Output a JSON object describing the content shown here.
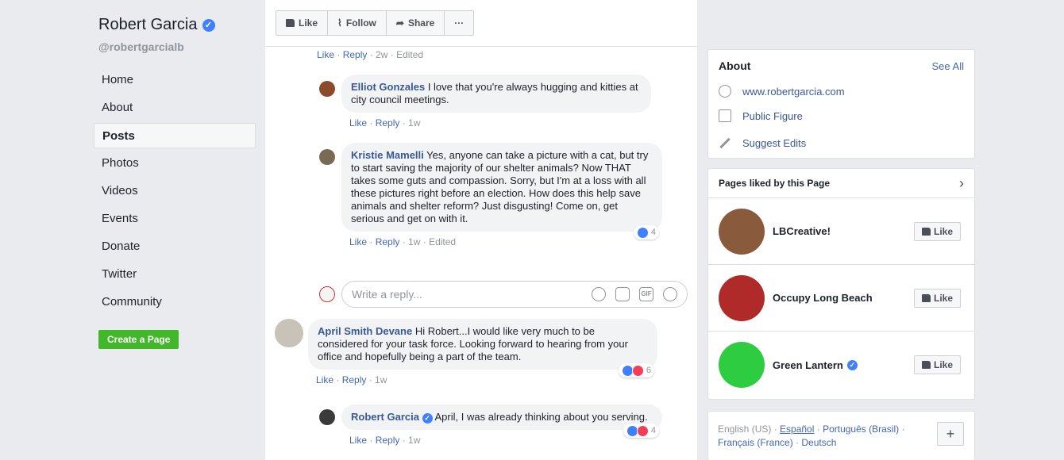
{
  "sidebar": {
    "page_name": "Robert Garcia",
    "handle": "@robertgarcialb",
    "nav": [
      "Home",
      "About",
      "Posts",
      "Photos",
      "Videos",
      "Events",
      "Donate",
      "Twitter",
      "Community"
    ],
    "active_item": "Posts",
    "create_page_label": "Create a Page"
  },
  "actionbar": {
    "like_label": "Like",
    "follow_label": "Follow",
    "share_label": "Share",
    "more_label": "···"
  },
  "comments": [
    {
      "meta": [
        "Like",
        "Reply",
        "2w",
        "Edited"
      ]
    },
    {
      "author": "Elliot Gonzales",
      "text": "I love that you're always hugging and kitties at city council meetings.",
      "meta": [
        "Like",
        "Reply",
        "1w"
      ]
    },
    {
      "author": "Kristie Mamelli",
      "text": "Yes, anyone can take a picture with a cat, but try to start saving the majority of our shelter animals? Now THAT takes some guts and compassion. Sorry, but I'm at a loss with all these pictures right before an election. How does this help save animals and shelter reform? Just disgusting! Come on, get serious and get on with it.",
      "meta": [
        "Like",
        "Reply",
        "1w",
        "Edited"
      ],
      "reactions": "4"
    },
    {
      "author": "April Smith Devane",
      "text": "Hi Robert...I would like very much to be considered for your task force. Looking forward to hearing from your office and hopefully being a part of the team.",
      "meta": [
        "Like",
        "Reply",
        "1w"
      ],
      "reactions": "6"
    },
    {
      "author": "Robert Garcia",
      "text": "April, I was already thinking about you serving.",
      "meta": [
        "Like",
        "Reply",
        "1w"
      ],
      "reactions": "4"
    }
  ],
  "reply_box": {
    "placeholder": "Write a reply...",
    "gif_label": "GIF"
  },
  "about": {
    "title": "About",
    "see_all": "See All",
    "website": "www.robertgarcia.com",
    "category": "Public Figure",
    "suggest": "Suggest Edits"
  },
  "pages_liked": {
    "title": "Pages liked by this Page",
    "like_label": "Like",
    "items": [
      {
        "name": "LBCreative!",
        "verified": false,
        "avatar_color": "#8a5a3c"
      },
      {
        "name": "Occupy Long Beach",
        "verified": false,
        "avatar_color": "#b02a2a"
      },
      {
        "name": "Green Lantern",
        "verified": true,
        "avatar_color": "#2ecc40"
      }
    ]
  },
  "languages": {
    "current": "English (US)",
    "items": [
      "Español",
      "Português (Brasil)",
      "Français (France)",
      "Deutsch"
    ],
    "plus_label": "+"
  },
  "colors": {
    "link": "#385898",
    "like_blue": "#4080ff",
    "love_red": "#f33e58",
    "green": "#42b72a"
  }
}
